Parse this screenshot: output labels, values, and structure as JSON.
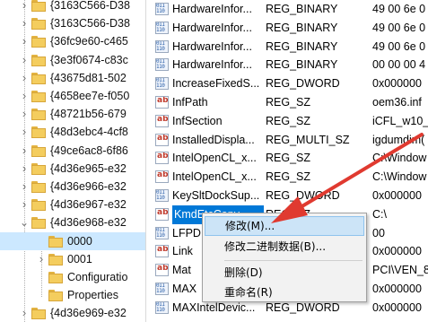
{
  "tree": {
    "items": [
      "{3163C566-D38",
      "{3163C566-D38",
      "{36fc9e60-c465",
      "{3e3f0674-c83c",
      "{43675d81-502",
      "{4658ee7e-f050",
      "{48721b56-679",
      "{48d3ebc4-4cf8",
      "{49ce6ac8-6f86",
      "{4d36e965-e32",
      "{4d36e966-e32",
      "{4d36e967-e32",
      "{4d36e968-e32",
      "0000",
      "0001",
      "Configuratio",
      "Properties",
      "{4d36e969-e32"
    ]
  },
  "values": {
    "rows": [
      {
        "icon": "binary-value-icon",
        "name": "HardwareInfor...",
        "type": "REG_BINARY",
        "data": "49 00 6e 0"
      },
      {
        "icon": "binary-value-icon",
        "name": "HardwareInfor...",
        "type": "REG_BINARY",
        "data": "49 00 6e 0"
      },
      {
        "icon": "binary-value-icon",
        "name": "HardwareInfor...",
        "type": "REG_BINARY",
        "data": "49 00 6e 0"
      },
      {
        "icon": "binary-value-icon",
        "name": "HardwareInfor...",
        "type": "REG_BINARY",
        "data": "00 00 00 4"
      },
      {
        "icon": "binary-value-icon",
        "name": "IncreaseFixedS...",
        "type": "REG_DWORD",
        "data": "0x000000"
      },
      {
        "icon": "string-value-icon",
        "name": "InfPath",
        "type": "REG_SZ",
        "data": "oem36.inf"
      },
      {
        "icon": "string-value-icon",
        "name": "InfSection",
        "type": "REG_SZ",
        "data": "iCFL_w10_D"
      },
      {
        "icon": "string-value-icon",
        "name": "InstalledDispla...",
        "type": "REG_MULTI_SZ",
        "data": "igdumdim("
      },
      {
        "icon": "string-value-icon",
        "name": "IntelOpenCL_x...",
        "type": "REG_SZ",
        "data": "C:\\Window"
      },
      {
        "icon": "string-value-icon",
        "name": "IntelOpenCL_x...",
        "type": "REG_SZ",
        "data": "C:\\Window"
      },
      {
        "icon": "binary-value-icon",
        "name": "KeySltDockSup...",
        "type": "REG_DWORD",
        "data": "0x000000"
      },
      {
        "icon": "string-value-icon",
        "name": "KmdEtcCopy",
        "type": "REG_SZ",
        "data": "C:\\"
      },
      {
        "icon": "binary-value-icon",
        "name": "LFPD",
        "type": "",
        "data": "00"
      },
      {
        "icon": "string-value-icon",
        "name": "Link",
        "type": "",
        "data": "0x000000"
      },
      {
        "icon": "string-value-icon",
        "name": "Mat",
        "type": "",
        "data": "PCI\\VEN_8"
      },
      {
        "icon": "binary-value-icon",
        "name": "MAX",
        "type": "",
        "data": "0x000000"
      },
      {
        "icon": "binary-value-icon",
        "name": "MAXIntelDevic...",
        "type": "REG_DWORD",
        "data": "0x000000"
      }
    ]
  },
  "context_menu": {
    "items": [
      "修改(M)...",
      "修改二进制数据(B)...",
      "删除(D)",
      "重命名(R)"
    ]
  },
  "colors": {
    "arrow": "#e03a30",
    "selection": "#0078d7",
    "menu_highlight": "#cce4f7"
  }
}
